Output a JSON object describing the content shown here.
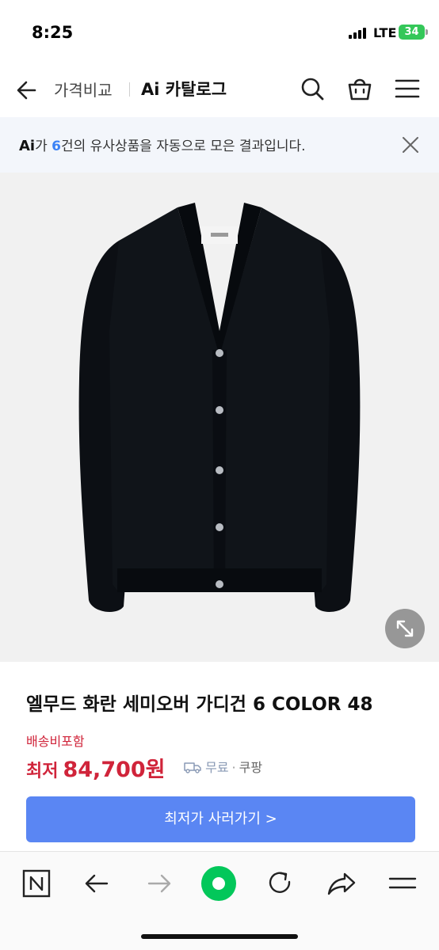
{
  "status_bar": {
    "time": "8:25",
    "network": "LTE",
    "battery": "34"
  },
  "header": {
    "back_icon": "arrow-left-icon",
    "crumb_compare": "가격비교",
    "crumb_catalog": "Ai 카탈로그",
    "search_icon": "search-icon",
    "cart_icon": "shopping-bag-icon",
    "menu_icon": "hamburger-menu-icon"
  },
  "ai_banner": {
    "ai_mark": "Ai",
    "prefix": "가 ",
    "count": "6",
    "suffix": "건의 유사상품을 자동으로 모은 결과입니다.",
    "close_icon": "close-icon"
  },
  "product": {
    "image_icon": "black-cardigan-image",
    "zoom_icon": "expand-icon",
    "title": "엘무드 화란 세미오버 가디건 6 COLOR 48",
    "shipping_note": "배송비포함",
    "price_label": "최저",
    "price": "84,700원",
    "delivery_label": "무료",
    "seller": "쿠팡",
    "cta_label": "최저가 사러가기 >"
  },
  "bottom_nav": {
    "items": [
      {
        "icon": "naver-n-icon"
      },
      {
        "icon": "back-arrow-icon"
      },
      {
        "icon": "forward-arrow-icon"
      },
      {
        "icon": "green-home-icon"
      },
      {
        "icon": "refresh-icon"
      },
      {
        "icon": "share-icon"
      },
      {
        "icon": "menu-icon"
      }
    ]
  },
  "colors": {
    "accent_blue": "#5a86f3",
    "price_red": "#d0243a",
    "naver_green": "#03c75a",
    "banner_bg": "#f3f6fb"
  }
}
